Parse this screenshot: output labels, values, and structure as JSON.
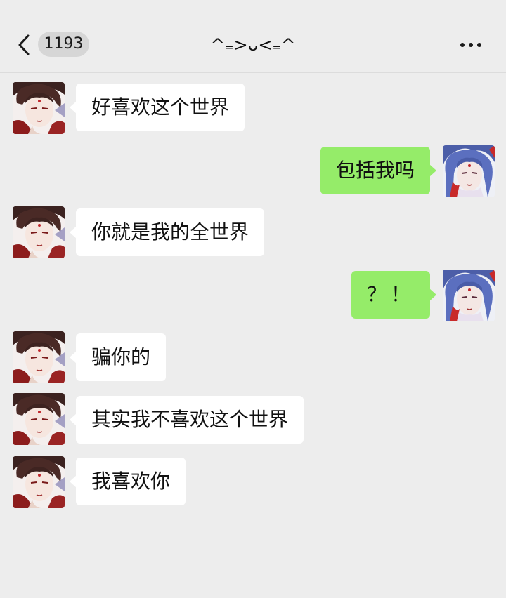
{
  "header": {
    "unread_count": "1193",
    "title": "^₌>ᴗ<₌^"
  },
  "messages": [
    {
      "side": "left",
      "text": "好喜欢这个世界"
    },
    {
      "side": "right",
      "text": "包括我吗"
    },
    {
      "side": "left",
      "text": "你就是我的全世界"
    },
    {
      "side": "right",
      "text": "？！"
    },
    {
      "side": "left",
      "text": "骗你的"
    },
    {
      "side": "left",
      "text": "其实我不喜欢这个世界"
    },
    {
      "side": "left",
      "text": "我喜欢你"
    }
  ],
  "colors": {
    "background": "#ededed",
    "own_bubble": "#95ec69",
    "other_bubble": "#ffffff"
  }
}
